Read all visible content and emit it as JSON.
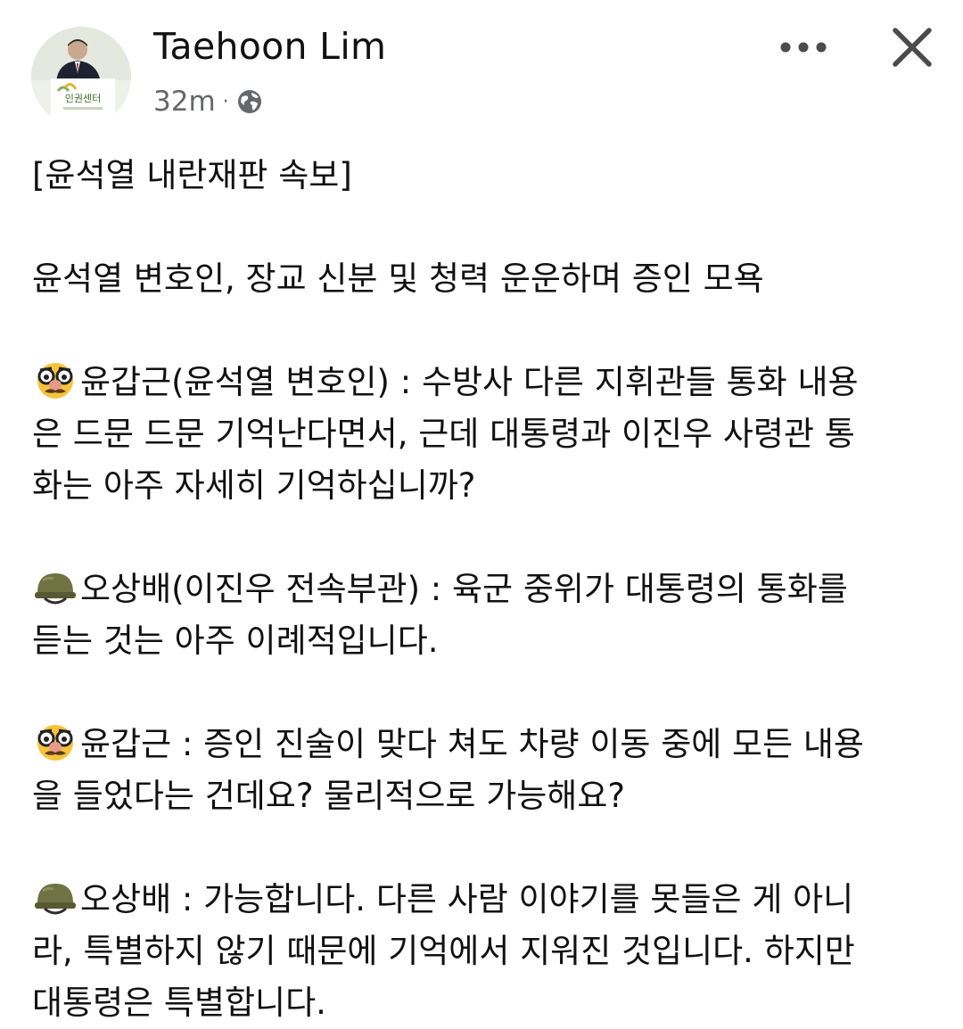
{
  "post": {
    "author": "Taehoon Lim",
    "time": "32m",
    "separator": "·",
    "privacy_icon": "globe-icon",
    "avatar_text": "인권센터",
    "actions": {
      "more_icon": "more-horizontal-icon",
      "close_icon": "close-icon"
    }
  },
  "content": {
    "title": "[윤석열 내란재판 속보]",
    "subtitle": "윤석열 변호인, 장교 신분 및 청력 운운하며 증인 모욕",
    "exchanges": [
      {
        "icon": "disguise-face-emoji",
        "lines": [
          "윤갑근(윤석열 변호인) : 수방사 다른 지휘관들 통화 내용",
          "은 드문 드문 기억난다면서, 근데 대통령과 이진우 사령관 통",
          "화는 아주 자세히 기억하십니까?"
        ]
      },
      {
        "icon": "military-helmet-emoji",
        "lines": [
          "오상배(이진우 전속부관) : 육군 중위가 대통령의 통화를",
          "듣는 것는 아주 이례적입니다."
        ]
      },
      {
        "icon": "disguise-face-emoji",
        "lines": [
          "윤갑근 : 증인 진술이 맞다 쳐도 차량 이동 중에 모든 내용",
          "을 들었다는 건데요? 물리적으로 가능해요?"
        ]
      },
      {
        "icon": "military-helmet-emoji",
        "lines": [
          "오상배 : 가능합니다. 다른 사람 이야기를 못들은 게 아니",
          "라, 특별하지 않기 때문에 기억에서 지워진 것입니다. 하지만",
          "대통령은 특별합니다."
        ]
      }
    ]
  },
  "colors": {
    "text": "#111111",
    "meta": "#65676b",
    "icon": "#4b4b4b",
    "background": "#ffffff"
  }
}
